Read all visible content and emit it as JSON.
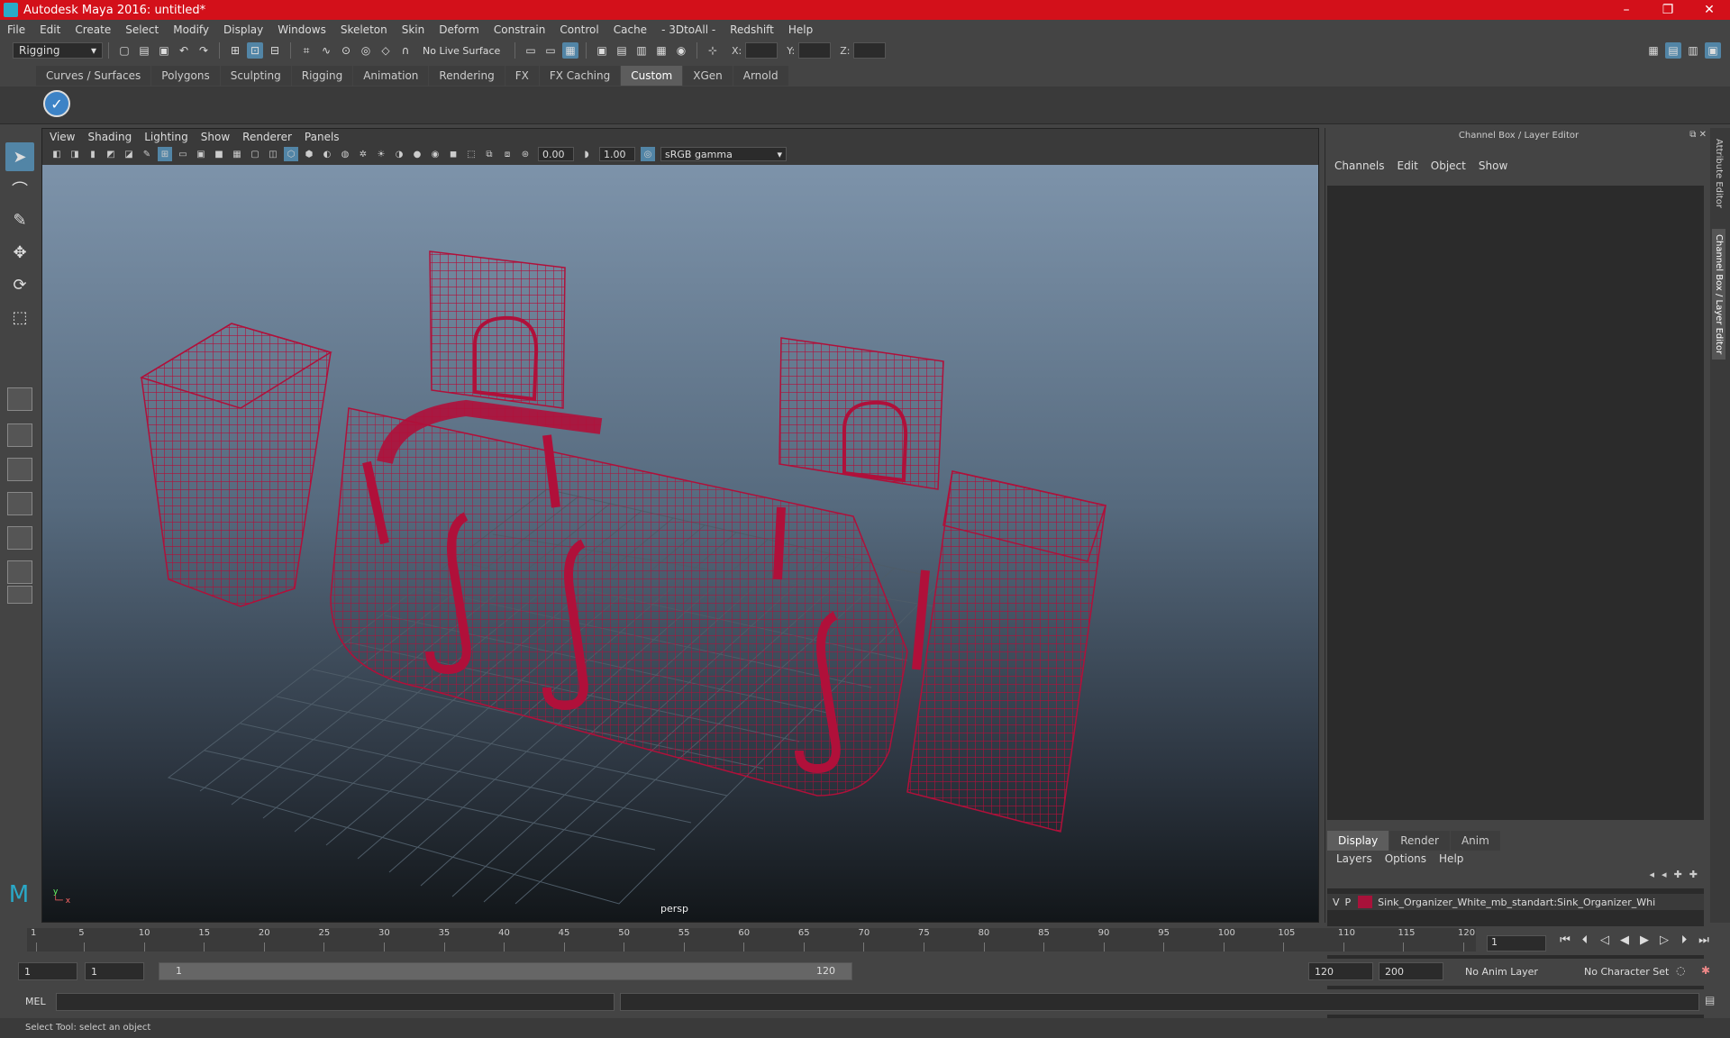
{
  "window": {
    "title": "Autodesk Maya 2016: untitled*"
  },
  "menu": [
    "File",
    "Edit",
    "Create",
    "Select",
    "Modify",
    "Display",
    "Windows",
    "Skeleton",
    "Skin",
    "Deform",
    "Constrain",
    "Control",
    "Cache",
    "- 3DtoAll -",
    "Redshift",
    "Help"
  ],
  "status": {
    "mode": "Rigging",
    "live_surface": "No Live Surface",
    "x_label": "X:",
    "y_label": "Y:",
    "z_label": "Z:"
  },
  "shelf_tabs": [
    "Curves / Surfaces",
    "Polygons",
    "Sculpting",
    "Rigging",
    "Animation",
    "Rendering",
    "FX",
    "FX Caching",
    "Custom",
    "XGen",
    "Arnold"
  ],
  "shelf_active": "Custom",
  "panel": {
    "menu": [
      "View",
      "Shading",
      "Lighting",
      "Show",
      "Renderer",
      "Panels"
    ],
    "exposure": "0.00",
    "gamma": "1.00",
    "color_space": "sRGB gamma",
    "camera_label": "persp"
  },
  "channel_box": {
    "title": "Channel Box / Layer Editor",
    "menu": [
      "Channels",
      "Edit",
      "Object",
      "Show"
    ],
    "layer_tabs": [
      "Display",
      "Render",
      "Anim"
    ],
    "layer_menu": [
      "Layers",
      "Options",
      "Help"
    ],
    "layer": {
      "v": "V",
      "p": "P",
      "name": "Sink_Organizer_White_mb_standart:Sink_Organizer_Whi",
      "color": "#a8123a"
    },
    "side_tabs": [
      "Attribute Editor",
      "Channel Box / Layer Editor"
    ]
  },
  "timeline": {
    "ticks": [
      "1",
      "5",
      "10",
      "15",
      "20",
      "25",
      "30",
      "35",
      "40",
      "45",
      "50",
      "55",
      "60",
      "65",
      "70",
      "75",
      "80",
      "85",
      "90",
      "95",
      "100",
      "105",
      "110",
      "115",
      "120"
    ],
    "current_frame": "1"
  },
  "range": {
    "start": "1",
    "playback_start": "1",
    "slider_start": "1",
    "slider_end": "120",
    "playback_end": "120",
    "end": "200",
    "anim_layer": "No Anim Layer",
    "character_set": "No Character Set"
  },
  "command": {
    "label": "MEL",
    "help": "Select Tool: select an object"
  },
  "colors": {
    "wireframe": "#b0103a",
    "title_bar": "#d3101a",
    "accent": "#5285a6"
  }
}
